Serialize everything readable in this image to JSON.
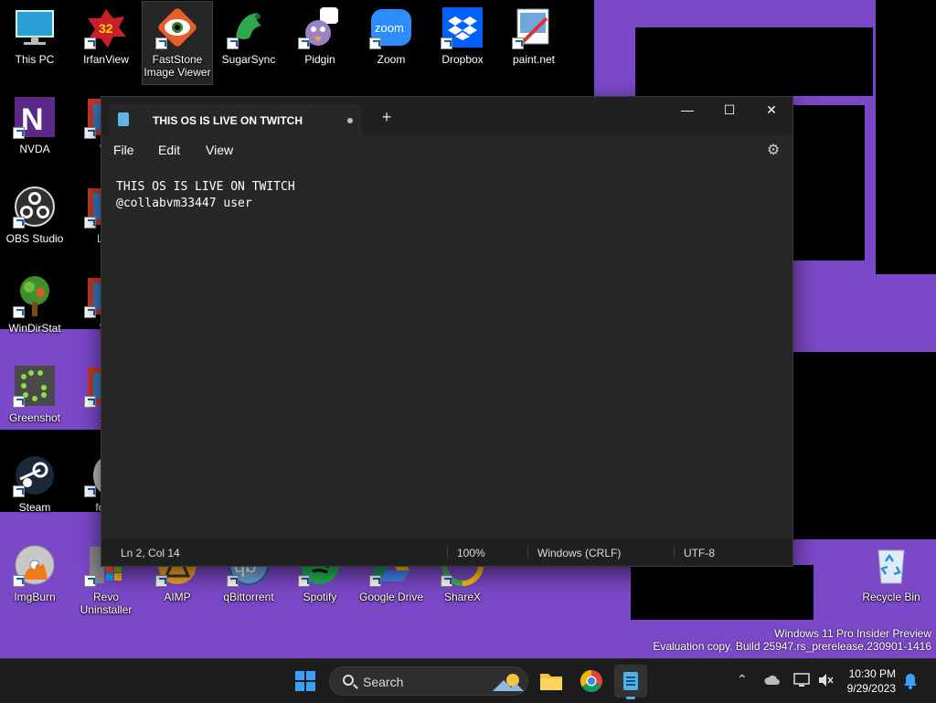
{
  "desktop": {
    "icons": [
      {
        "label": "This PC",
        "icon": "pc-icon"
      },
      {
        "label": "IrfanView",
        "icon": "irfanview-icon",
        "badge": "32"
      },
      {
        "label": "FastStone Image Viewer",
        "icon": "faststone-icon"
      },
      {
        "label": "SugarSync",
        "icon": "sugarsync-icon"
      },
      {
        "label": "Pidgin",
        "icon": "pidgin-icon"
      },
      {
        "label": "Zoom",
        "icon": "zoom-icon",
        "badge": "zoom"
      },
      {
        "label": "Dropbox",
        "icon": "dropbox-icon"
      },
      {
        "label": "paint.net",
        "icon": "paintnet-icon"
      },
      {
        "label": "NVDA",
        "icon": "nvda-icon"
      },
      {
        "label": "Wi",
        "icon": "app-icon"
      },
      {
        "label": "OBS Studio",
        "icon": "obs-icon"
      },
      {
        "label": "Lau",
        "icon": "app-icon"
      },
      {
        "label": "WinDirStat",
        "icon": "windirstat-icon"
      },
      {
        "label": "Wi",
        "icon": "app-icon"
      },
      {
        "label": "Greenshot",
        "icon": "greenshot-icon"
      },
      {
        "label": "Xn",
        "icon": "app-icon"
      },
      {
        "label": "Steam",
        "icon": "steam-icon"
      },
      {
        "label": "foob",
        "icon": "foobar-icon"
      },
      {
        "label": "ImgBurn",
        "icon": "imgburn-icon"
      },
      {
        "label": "Revo Uninstaller",
        "icon": "revo-icon"
      },
      {
        "label": "AIMP",
        "icon": "aimp-icon"
      },
      {
        "label": "qBittorrent",
        "icon": "qbittorrent-icon"
      },
      {
        "label": "Spotify",
        "icon": "spotify-icon"
      },
      {
        "label": "Google Drive",
        "icon": "googledrive-icon"
      },
      {
        "label": "ShareX",
        "icon": "sharex-icon"
      },
      {
        "label": "Recycle Bin",
        "icon": "recycle-bin-icon"
      }
    ]
  },
  "notepad": {
    "tab_title": "THIS OS IS LIVE ON TWITCH",
    "menu": [
      "File",
      "Edit",
      "View"
    ],
    "lines": [
      "THIS OS IS LIVE ON TWITCH",
      "@collabvm33447 user"
    ],
    "status": {
      "position": "Ln 2, Col 14",
      "zoom": "100%",
      "line_ending": "Windows (CRLF)",
      "encoding": "UTF-8"
    }
  },
  "taskbar": {
    "search_label": "Search",
    "clock_time": "10:30 PM",
    "clock_date": "9/29/2023"
  },
  "watermark": {
    "line1": "Windows 11 Pro Insider Preview",
    "line2": "Evaluation copy. Build 25947.rs_prerelease.230901-1416"
  },
  "colors": {
    "wallpaper_purple": "#7b48c8",
    "notepad_bg": "#272727",
    "taskbar_bg": "#1c1c1c"
  }
}
